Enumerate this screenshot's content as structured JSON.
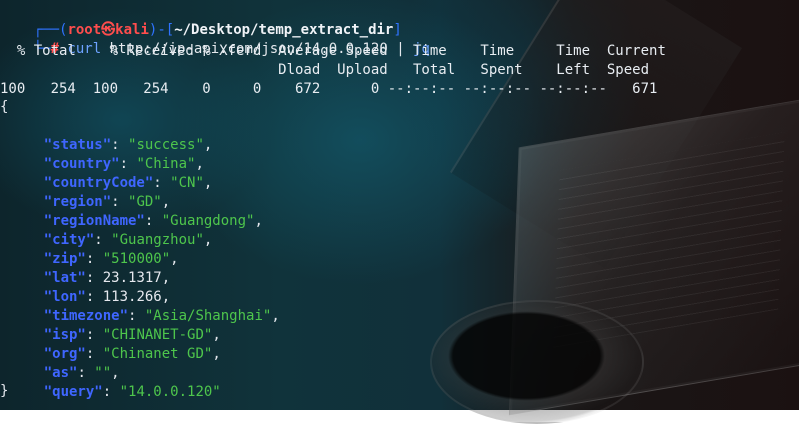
{
  "colors": {
    "prompt_blue": "#2f73ff",
    "prompt_red": "#ff4d4d",
    "json_key": "#3f66ff",
    "json_string": "#4ec64c"
  },
  "prompt": {
    "corner_top": "┌──",
    "open_paren": "(",
    "user": "root",
    "skull": "㉿",
    "host": "kali",
    "close_paren": ")",
    "dash": "-",
    "bracket_open": "[",
    "path": "~/Desktop/temp_extract_dir",
    "bracket_close": "]",
    "corner_bottom": "└─",
    "hash": "#",
    "command": "curl",
    "url": "http://ip-api.com/json/14.0.0.120",
    "pipe": "|",
    "jq": "jq"
  },
  "curl_table": {
    "header_1": "  % Total    % Received % Xferd  Average Speed   Time    Time     Time  Current",
    "header_2": "                                 Dload  Upload   Total   Spent    Left  Speed",
    "progress_row": "100   254  100   254    0     0    672      0 --:--:-- --:--:-- --:--:--   671"
  },
  "json_output": {
    "open": "{",
    "close": "}",
    "fields": [
      {
        "key": "\"status\"",
        "value": "\"success\"",
        "type": "string",
        "comma": ","
      },
      {
        "key": "\"country\"",
        "value": "\"China\"",
        "type": "string",
        "comma": ","
      },
      {
        "key": "\"countryCode\"",
        "value": "\"CN\"",
        "type": "string",
        "comma": ","
      },
      {
        "key": "\"region\"",
        "value": "\"GD\"",
        "type": "string",
        "comma": ","
      },
      {
        "key": "\"regionName\"",
        "value": "\"Guangdong\"",
        "type": "string",
        "comma": ","
      },
      {
        "key": "\"city\"",
        "value": "\"Guangzhou\"",
        "type": "string",
        "comma": ","
      },
      {
        "key": "\"zip\"",
        "value": "\"510000\"",
        "type": "string",
        "comma": ","
      },
      {
        "key": "\"lat\"",
        "value": "23.1317",
        "type": "number",
        "comma": ","
      },
      {
        "key": "\"lon\"",
        "value": "113.266",
        "type": "number",
        "comma": ","
      },
      {
        "key": "\"timezone\"",
        "value": "\"Asia/Shanghai\"",
        "type": "string",
        "comma": ","
      },
      {
        "key": "\"isp\"",
        "value": "\"CHINANET-GD\"",
        "type": "string",
        "comma": ","
      },
      {
        "key": "\"org\"",
        "value": "\"Chinanet GD\"",
        "type": "string",
        "comma": ","
      },
      {
        "key": "\"as\"",
        "value": "\"\"",
        "type": "string",
        "comma": ","
      },
      {
        "key": "\"query\"",
        "value": "\"14.0.0.120\"",
        "type": "string",
        "comma": ""
      }
    ]
  }
}
